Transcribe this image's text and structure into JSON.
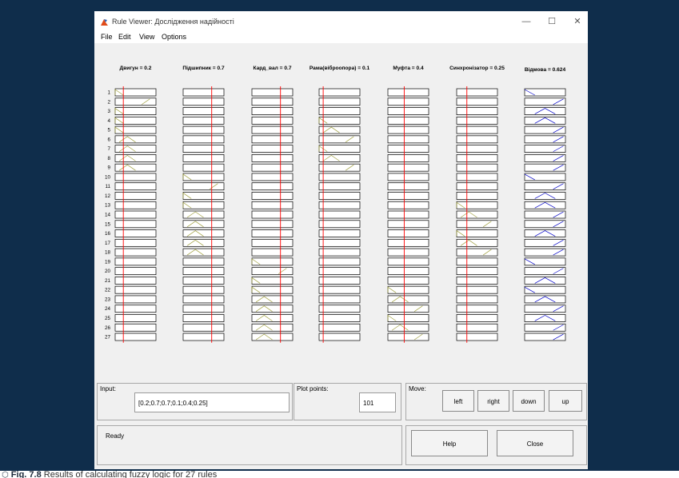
{
  "window": {
    "title": "Rule Viewer: Дослідження надійності",
    "controls": [
      "—",
      "☐",
      "✕"
    ]
  },
  "menu": [
    "File",
    "Edit",
    "View",
    "Options"
  ],
  "inputs": [
    {
      "name": "Двигун",
      "value": 0.2
    },
    {
      "name": "Підшипник",
      "value": 0.7
    },
    {
      "name": "Кард_вал",
      "value": 0.7
    },
    {
      "name": "Рама(віброопора)",
      "value": 0.1
    },
    {
      "name": "Муфта",
      "value": 0.4
    },
    {
      "name": "Синхронізатор",
      "value": 0.25
    }
  ],
  "output": {
    "name": "Відмова",
    "value": 0.624
  },
  "headers": [
    "Двигун = 0.2",
    "Підшипник = 0.7",
    "Кард_вал = 0.7",
    "Рама(віброопора) = 0.1",
    "Муфта = 0.4",
    "Синхронізатор = 0.25",
    "Відмова = 0.624"
  ],
  "rule_numbers": [
    "1",
    "2",
    "3",
    "4",
    "5",
    "6",
    "7",
    "8",
    "9",
    "10",
    "11",
    "12",
    "13",
    "14",
    "15",
    "16",
    "17",
    "18",
    "19",
    "20",
    "21",
    "22",
    "23",
    "24",
    "25",
    "26",
    "27"
  ],
  "rules": [
    {
      "in": [
        1,
        0,
        0,
        0,
        0,
        0
      ],
      "out": 1
    },
    {
      "in": [
        3,
        0,
        0,
        0,
        0,
        0
      ],
      "out": 3
    },
    {
      "in": [
        1,
        0,
        0,
        0,
        0,
        0
      ],
      "out": 2
    },
    {
      "in": [
        1,
        0,
        0,
        1,
        0,
        0
      ],
      "out": 2
    },
    {
      "in": [
        1,
        0,
        0,
        2,
        0,
        0
      ],
      "out": 3
    },
    {
      "in": [
        2,
        0,
        0,
        3,
        0,
        0
      ],
      "out": 3
    },
    {
      "in": [
        2,
        0,
        0,
        1,
        0,
        0
      ],
      "out": 3
    },
    {
      "in": [
        2,
        0,
        0,
        2,
        0,
        0
      ],
      "out": 3
    },
    {
      "in": [
        2,
        0,
        0,
        3,
        0,
        0
      ],
      "out": 3
    },
    {
      "in": [
        0,
        1,
        0,
        0,
        0,
        0
      ],
      "out": 1
    },
    {
      "in": [
        0,
        3,
        0,
        0,
        0,
        0
      ],
      "out": 3
    },
    {
      "in": [
        0,
        1,
        0,
        0,
        0,
        0
      ],
      "out": 2
    },
    {
      "in": [
        0,
        1,
        0,
        0,
        0,
        1
      ],
      "out": 2
    },
    {
      "in": [
        0,
        2,
        0,
        0,
        0,
        2
      ],
      "out": 3
    },
    {
      "in": [
        0,
        2,
        0,
        0,
        0,
        3
      ],
      "out": 3
    },
    {
      "in": [
        0,
        2,
        0,
        0,
        0,
        1
      ],
      "out": 2
    },
    {
      "in": [
        0,
        2,
        0,
        0,
        0,
        2
      ],
      "out": 3
    },
    {
      "in": [
        0,
        2,
        0,
        0,
        0,
        3
      ],
      "out": 3
    },
    {
      "in": [
        0,
        0,
        1,
        0,
        0,
        0
      ],
      "out": 1
    },
    {
      "in": [
        0,
        0,
        3,
        0,
        0,
        0
      ],
      "out": 3
    },
    {
      "in": [
        0,
        0,
        1,
        0,
        0,
        0
      ],
      "out": 2
    },
    {
      "in": [
        0,
        0,
        1,
        0,
        1,
        0
      ],
      "out": 1
    },
    {
      "in": [
        0,
        0,
        2,
        0,
        2,
        0
      ],
      "out": 2
    },
    {
      "in": [
        0,
        0,
        2,
        0,
        3,
        0
      ],
      "out": 3
    },
    {
      "in": [
        0,
        0,
        2,
        0,
        1,
        0
      ],
      "out": 2
    },
    {
      "in": [
        0,
        0,
        2,
        0,
        2,
        0
      ],
      "out": 3
    },
    {
      "in": [
        0,
        0,
        2,
        0,
        3,
        0
      ],
      "out": 3
    }
  ],
  "panel": {
    "input_label": "Input:",
    "input_value": "[0.2;0.7;0.7;0.1;0.4;0.25]",
    "plot_points_label": "Plot points:",
    "plot_points_value": "101",
    "move_label": "Move:",
    "move_buttons": [
      "left",
      "right",
      "down",
      "up"
    ],
    "status": "Ready",
    "help_label": "Help",
    "close_label": "Close"
  },
  "caption": {
    "icon": "book-icon",
    "figure": "Fig. 7.8",
    "text": " Results of calculating fuzzy logic for 27 rules"
  },
  "colors": {
    "frame": "#0f2d4b",
    "window_bg": "#f0f0f0",
    "input_line": "#a0a040",
    "input_fill": "#ffff00",
    "indicator": "#ff0000",
    "output_line": "#0000c8",
    "output_fill": "#4040ff"
  }
}
